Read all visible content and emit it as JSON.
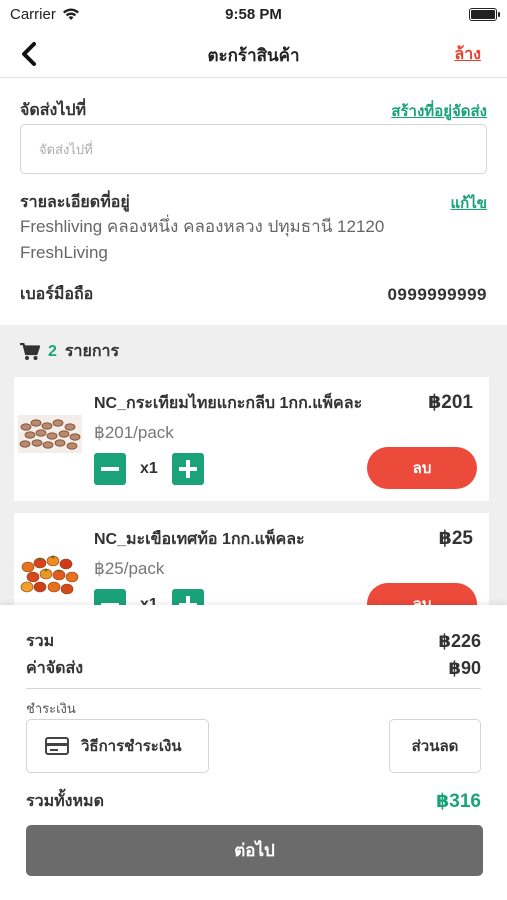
{
  "status_bar": {
    "carrier": "Carrier",
    "time": "9:58 PM"
  },
  "nav": {
    "title": "ตะกร้าสินค้า",
    "clear_label": "ล้าง"
  },
  "shipping": {
    "label": "จัดส่งไปที่",
    "create_link": "สร้างที่อยู่จัดส่ง",
    "input_placeholder": "จัดส่งไปที่",
    "address_label": "รายละเอียดที่อยู่",
    "edit_link": "แก้ไข",
    "address_line1": "Freshliving คลองหนึ่ง คลองหลวง ปทุมธานี 12120",
    "address_line2": "FreshLiving",
    "phone_label": "เบอร์มือถือ",
    "phone_value": "0999999999"
  },
  "cart": {
    "count": "2",
    "count_label": "รายการ",
    "items": [
      {
        "name": "NC_กระเทียมไทยแกะกลีบ 1กก.แพ็คละ",
        "price": "฿201",
        "unit_price": "฿201/pack",
        "qty": "x1",
        "delete_label": "ลบ",
        "image": "garlic-photo"
      },
      {
        "name": "NC_มะเขือเทศท้อ 1กก.แพ็คละ",
        "price": "฿25",
        "unit_price": "฿25/pack",
        "qty": "x1",
        "delete_label": "ลบ",
        "image": "tomato-photo"
      }
    ]
  },
  "summary": {
    "subtotal_label": "รวม",
    "subtotal_value": "฿226",
    "shipping_label": "ค่าจัดส่ง",
    "shipping_value": "฿90",
    "payment_label": "ชำระเงิน",
    "payment_method": "วิธีการชำระเงิน",
    "discount": "ส่วนลด",
    "total_label": "รวมทั้งหมด",
    "total_value": "฿316",
    "next_label": "ต่อไป"
  },
  "colors": {
    "accent": "#1aa37a",
    "danger": "#ec4a3a",
    "button_gray": "#6b6b6b"
  }
}
